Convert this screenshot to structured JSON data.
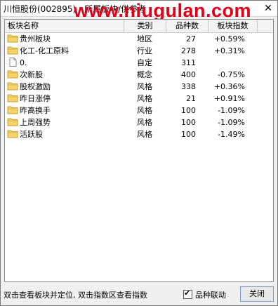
{
  "window": {
    "title": "川恒股份(002895) - 所属板块/供参考",
    "watermark": "www.niugulan.com"
  },
  "table": {
    "headers": [
      "板块名称",
      "类别",
      "品种数",
      "板块指数"
    ],
    "rows": [
      {
        "icon": "folder-icon",
        "name": "贵州板块",
        "type": "地区",
        "count": "27",
        "index": "+0.59%"
      },
      {
        "icon": "folder-icon",
        "name": "化工-化工原料",
        "type": "行业",
        "count": "278",
        "index": "+0.31%"
      },
      {
        "icon": "document-icon",
        "name": "0.",
        "type": "自定",
        "count": "311",
        "index": ""
      },
      {
        "icon": "folder-icon",
        "name": "次新股",
        "type": "概念",
        "count": "400",
        "index": "-0.75%"
      },
      {
        "icon": "folder-icon",
        "name": "股权激励",
        "type": "风格",
        "count": "338",
        "index": "+0.36%"
      },
      {
        "icon": "folder-icon",
        "name": "昨日涨停",
        "type": "风格",
        "count": "21",
        "index": "+0.91%"
      },
      {
        "icon": "folder-icon",
        "name": "昨高换手",
        "type": "风格",
        "count": "100",
        "index": "-1.09%"
      },
      {
        "icon": "folder-icon",
        "name": "上周强势",
        "type": "风格",
        "count": "100",
        "index": "-1.09%"
      },
      {
        "icon": "folder-icon",
        "name": "活跃股",
        "type": "风格",
        "count": "100",
        "index": "-1.49%"
      }
    ]
  },
  "status": {
    "hint": "双击查看板块并定位, 双击指数区查看指数",
    "linkage_label": "品种联动",
    "linkage_checked": true,
    "close_label": "关闭"
  },
  "colors": {
    "watermark": "#e0001a",
    "folder_fill": "#f5d36b",
    "folder_edge": "#c9a12c"
  }
}
